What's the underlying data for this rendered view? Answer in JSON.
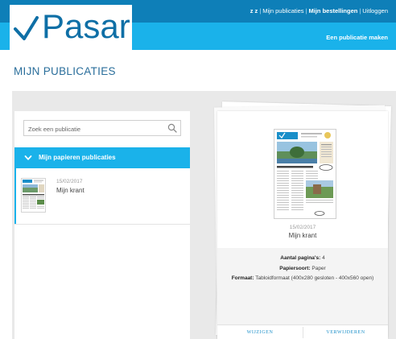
{
  "header": {
    "logo_text": "Pasar",
    "user": "z z",
    "nav": [
      "Mijn publicaties",
      "Mijn bestellingen",
      "Uitloggen"
    ],
    "new_publication": "Een publicatie maken",
    "colors": {
      "top_bar": "#0e7fb8",
      "bottom_bar": "#1ab2ea",
      "logo": "#0e6fa6"
    }
  },
  "page": {
    "title": "MIJN PUBLICATIES"
  },
  "sidebar": {
    "search": {
      "placeholder": "Zoek een publicatie",
      "value": "",
      "icon": "search-icon"
    },
    "folder": {
      "label": "Mijn papieren publicaties",
      "icon": "chevron-down-icon"
    },
    "items": [
      {
        "date": "15/02/2017",
        "name": "Mijn krant"
      }
    ]
  },
  "detail": {
    "date": "15/02/2017",
    "name": "Mijn krant",
    "pages_label": "Aantal pagina's:",
    "pages_value": "4",
    "paper_label": "Papiersoort:",
    "paper_value": "Paper",
    "format_label": "Formaat:",
    "format_value": "Tabloidformaat (400x280 gesloten - 400x560 open)",
    "edit_button": "WIJZIGEN",
    "delete_button": "VERWIJDEREN"
  }
}
